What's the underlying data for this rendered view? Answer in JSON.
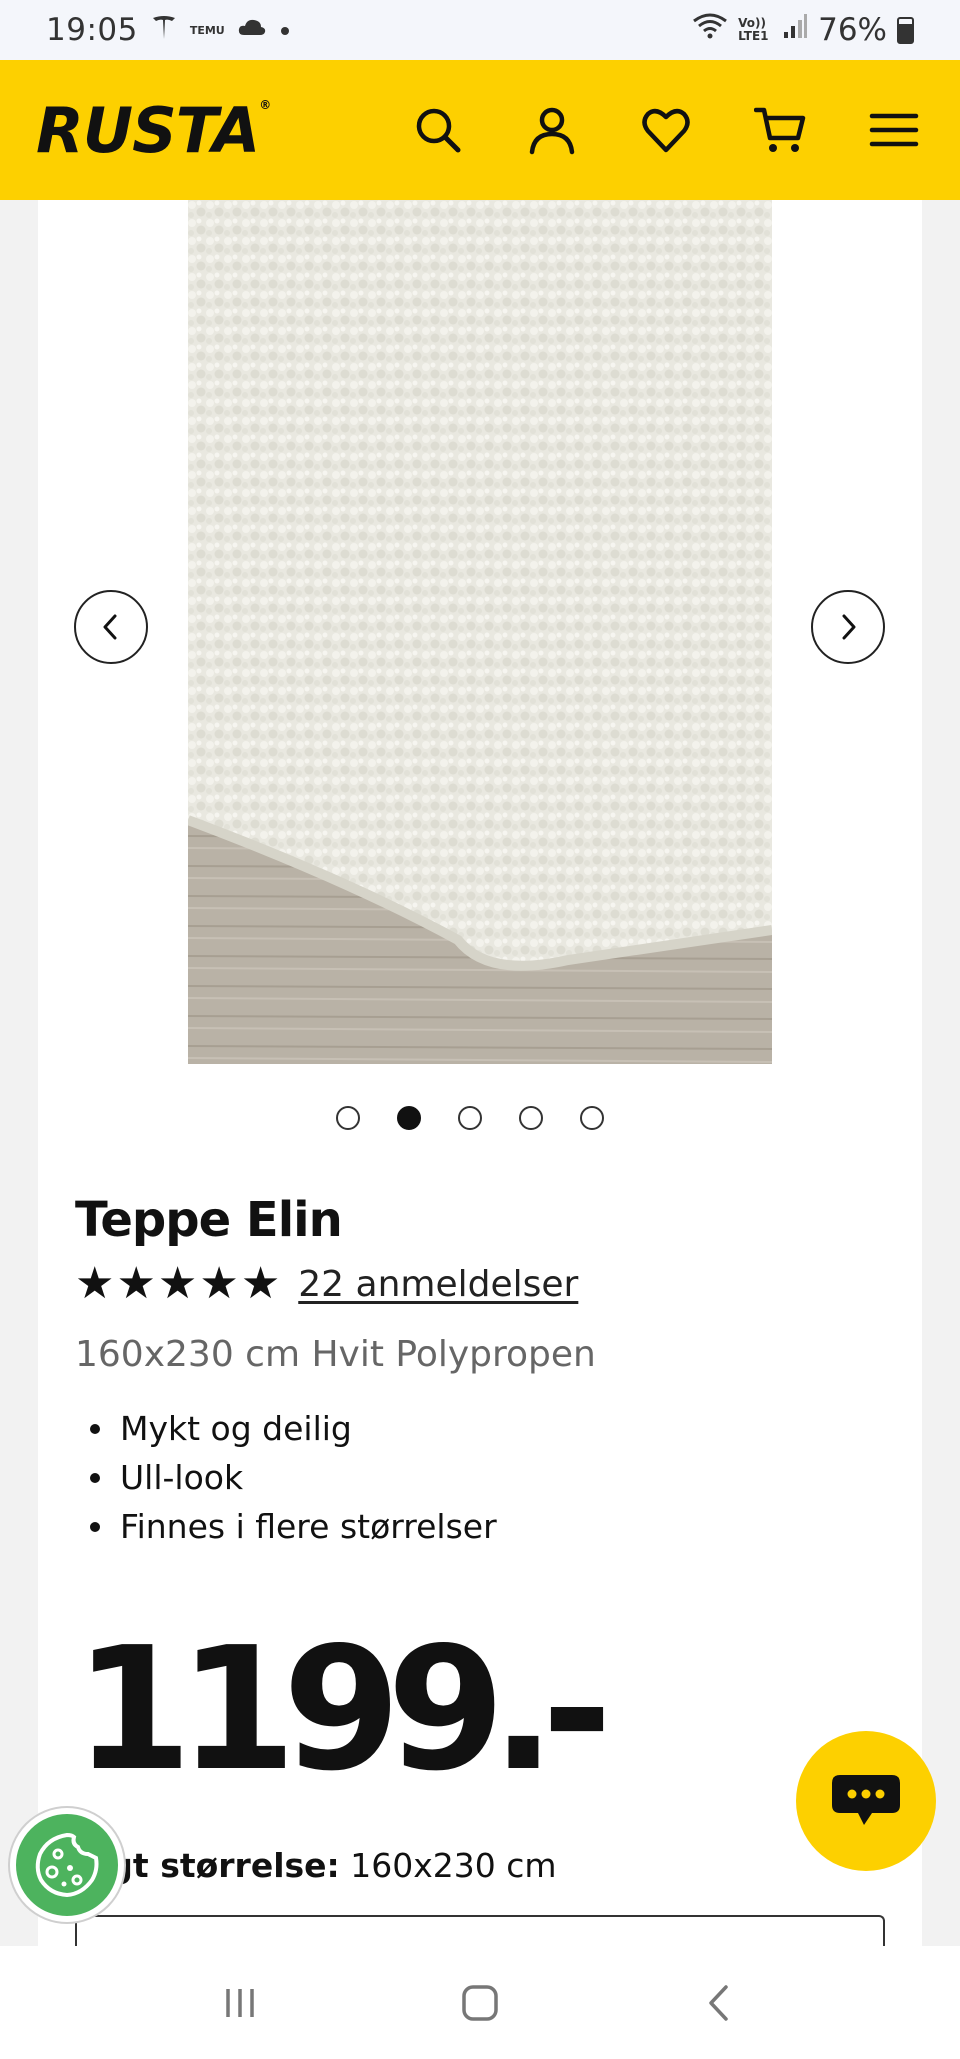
{
  "status_bar": {
    "time": "19:05",
    "left_icons": [
      "tesla-icon",
      "temu-icon",
      "cloud-icon",
      "dot-icon"
    ],
    "temu_text": "TEMU",
    "network": "Vo)) LTE1",
    "battery": "76%"
  },
  "header": {
    "logo": "RUSTA",
    "icons": [
      "search-icon",
      "account-icon",
      "wishlist-icon",
      "cart-icon",
      "menu-icon"
    ],
    "background": "#fdd000"
  },
  "gallery": {
    "image_alt": "white shaggy rug on wooden floor",
    "dot_count": 5,
    "active_index": 1
  },
  "product": {
    "title": "Teppe Elin",
    "rating_stars": 5,
    "reviews": "22 anmeldelser",
    "subtitle": "160x230 cm Hvit Polypropen",
    "features": [
      "Mykt og deilig",
      "Ull-look",
      "Finnes i flere størrelser"
    ],
    "price": "1199.-",
    "size_label": "lgt størrelse:",
    "size_value": "160x230 cm"
  },
  "colors": {
    "brand_yellow": "#fdd000",
    "cookie_green": "#4db35e"
  }
}
